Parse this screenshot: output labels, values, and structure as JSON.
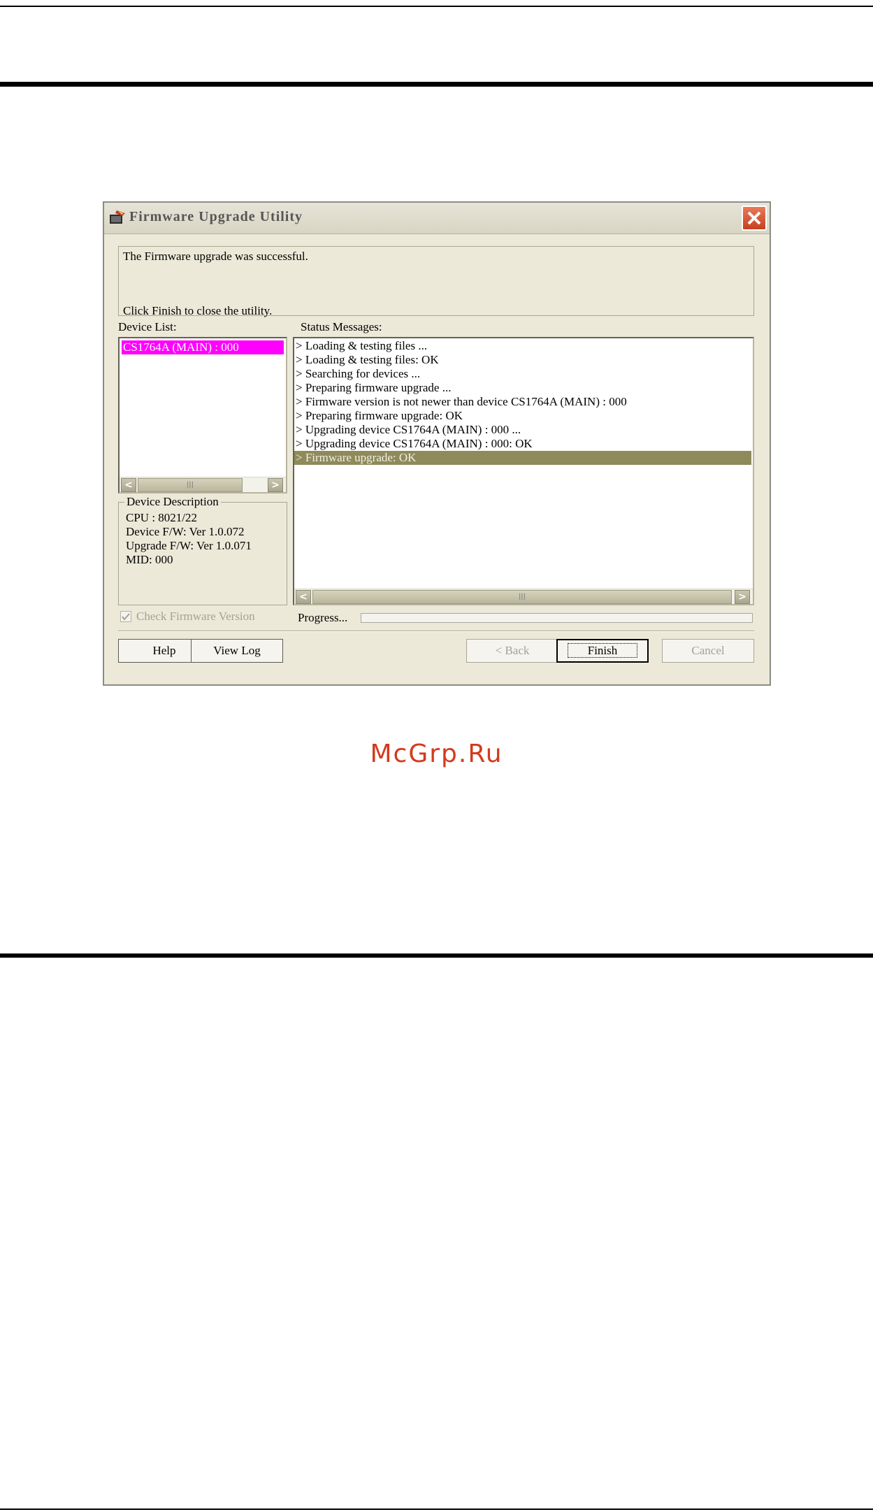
{
  "window": {
    "title": "Firmware Upgrade Utility",
    "close_icon": "close-icon"
  },
  "message": {
    "line1": "The Firmware upgrade was successful.",
    "line2": "Click Finish to close the utility."
  },
  "device_list": {
    "label": "Device List:",
    "items": [
      "CS1764A (MAIN) : 000"
    ],
    "selected_color": "#ff00ff"
  },
  "device_description": {
    "legend": "Device Description",
    "lines": [
      "CPU : 8021/22",
      "Device F/W: Ver 1.0.072",
      "Upgrade F/W: Ver 1.0.071",
      "MID: 000"
    ]
  },
  "status": {
    "label": "Status Messages:",
    "messages": [
      "> Loading & testing files ...",
      "> Loading & testing files: OK",
      "> Searching for devices ...",
      "> Preparing firmware upgrade ...",
      "> Firmware version is not newer than device CS1764A (MAIN) : 000",
      "> Preparing firmware upgrade: OK",
      "> Upgrading device CS1764A (MAIN) : 000 ...",
      "> Upgrading device CS1764A (MAIN) : 000: OK",
      "> Firmware upgrade: OK"
    ],
    "selected_index": 8,
    "selected_color": "#8e8a5a"
  },
  "options": {
    "check_firmware_label": "Check Firmware Version",
    "check_firmware_checked": true,
    "progress_label": "Progress...",
    "progress_value": 0
  },
  "buttons": {
    "help": "Help",
    "view_log": "View Log",
    "back": "< Back",
    "finish": "Finish",
    "cancel": "Cancel"
  },
  "watermark": "McGrp.Ru"
}
